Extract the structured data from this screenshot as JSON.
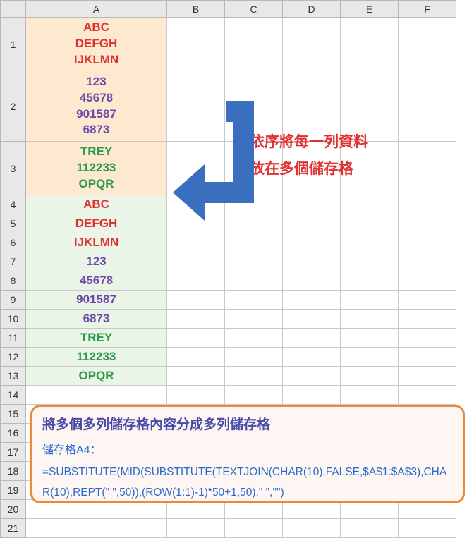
{
  "columns": [
    "A",
    "B",
    "C",
    "D",
    "E",
    "F"
  ],
  "rows_count": 21,
  "cellsA": {
    "1": {
      "text": "ABC\nDEFGH\nIJKLMN",
      "bg": "bg-orange",
      "color": "c-red",
      "multi": true
    },
    "2": {
      "text": "123\n45678\n901587\n6873",
      "bg": "bg-orange",
      "color": "c-purple",
      "multi": true
    },
    "3": {
      "text": "TREY\n112233\nOPQR",
      "bg": "bg-orange",
      "color": "c-green",
      "multi": true
    },
    "4": {
      "text": "ABC",
      "bg": "bg-green",
      "color": "c-red"
    },
    "5": {
      "text": "DEFGH",
      "bg": "bg-green",
      "color": "c-red"
    },
    "6": {
      "text": "IJKLMN",
      "bg": "bg-green",
      "color": "c-red"
    },
    "7": {
      "text": "123",
      "bg": "bg-green",
      "color": "c-purple"
    },
    "8": {
      "text": "45678",
      "bg": "bg-green",
      "color": "c-purple"
    },
    "9": {
      "text": "901587",
      "bg": "bg-green",
      "color": "c-purple"
    },
    "10": {
      "text": "6873",
      "bg": "bg-green",
      "color": "c-purple"
    },
    "11": {
      "text": "TREY",
      "bg": "bg-green",
      "color": "c-green"
    },
    "12": {
      "text": "112233",
      "bg": "bg-green",
      "color": "c-green"
    },
    "13": {
      "text": "OPQR",
      "bg": "bg-green",
      "color": "c-green"
    }
  },
  "annotation": {
    "line1": "依序將每一列資料",
    "line2": "放在多個儲存格"
  },
  "formula": {
    "title": "將多個多列儲存格內容分成多列儲存格",
    "sub": "儲存格A4：",
    "code": "=SUBSTITUTE(MID(SUBSTITUTE(TEXTJOIN(CHAR(10),FALSE,$A$1:$A$3),CHAR(10),REPT(\" \",50)),(ROW(1:1)-1)*50+1,50),\" \",\"\")"
  }
}
